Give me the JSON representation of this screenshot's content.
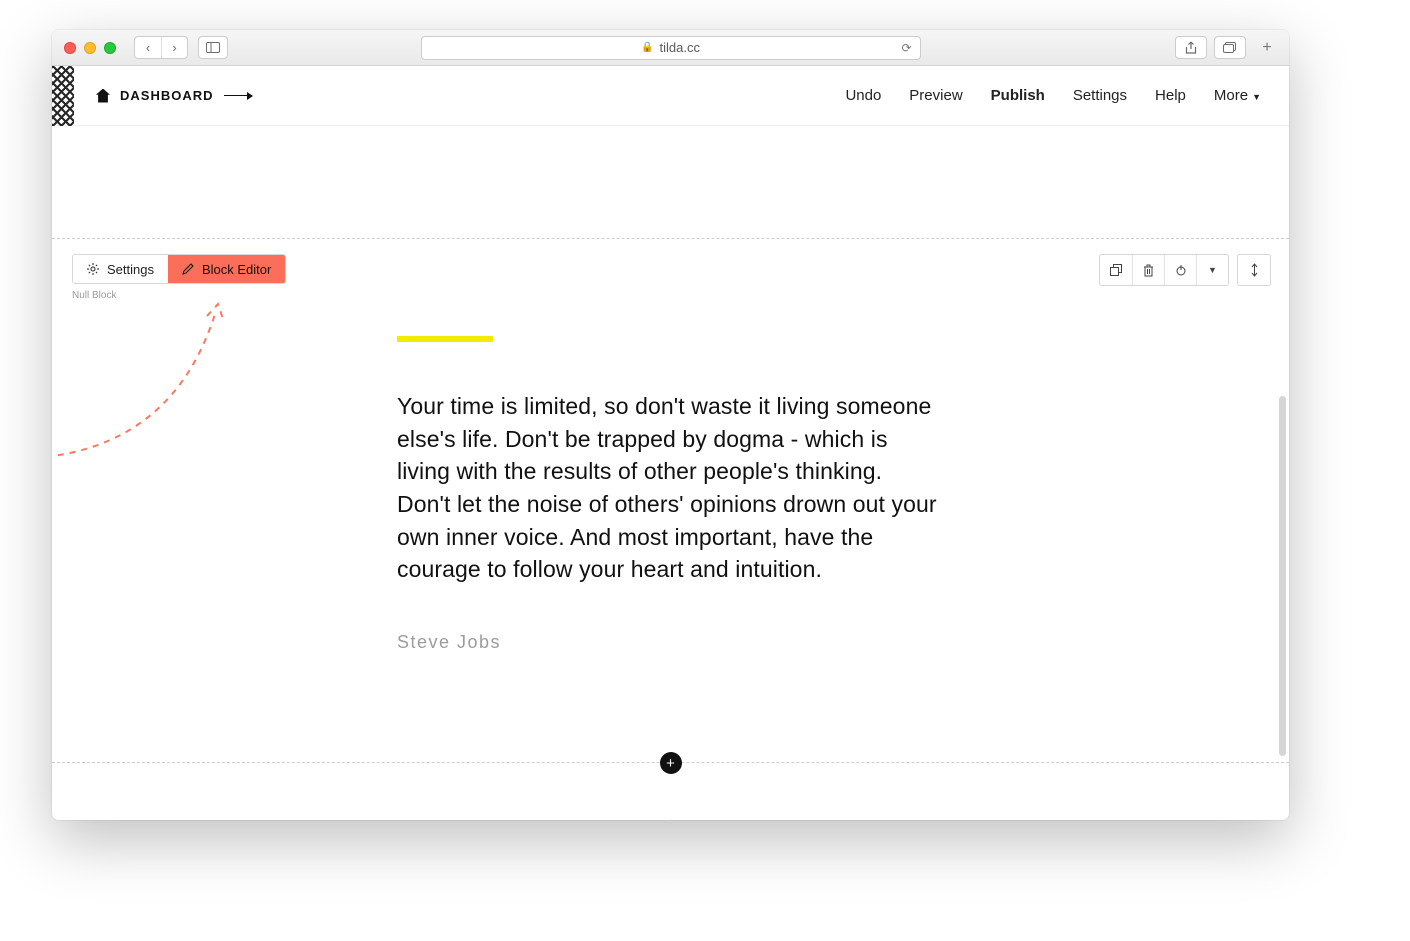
{
  "browser": {
    "url": "tilda.cc"
  },
  "nav": {
    "dashboard_label": "DASHBOARD",
    "undo": "Undo",
    "preview": "Preview",
    "publish": "Publish",
    "settings": "Settings",
    "help": "Help",
    "more": "More"
  },
  "block_toolbar": {
    "settings": "Settings",
    "block_editor": "Block Editor",
    "null_label": "Null Block"
  },
  "quote": {
    "text": "Your time is limited, so don't waste it living someone else's life. Don't be trapped by dogma - which is living with the results of other people's thinking. Don't let the noise of others' opinions drown out your own inner voice. And most important, have the courage to follow your heart and intuition.",
    "author": "Steve Jobs"
  },
  "add_button": "+",
  "colors": {
    "accent_red": "#fa6e5a",
    "accent_yellow": "#f2ea00"
  }
}
